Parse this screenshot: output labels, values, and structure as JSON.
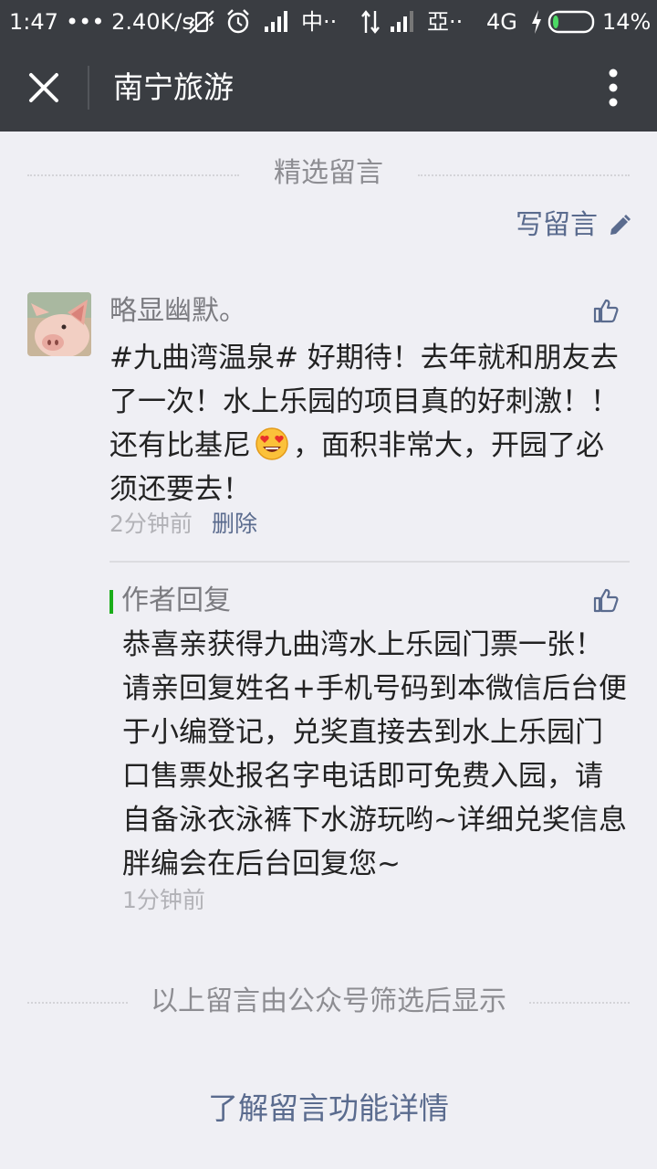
{
  "status_bar": {
    "time": "1:47",
    "speed": "••• 2.40K/s",
    "carrier1": "中··",
    "carrier2": "亞··",
    "network": "4G",
    "battery": "14%",
    "battery_level": 0.14
  },
  "header": {
    "title": "南宁旅游"
  },
  "section": {
    "title": "精选留言",
    "write_label": "写留言"
  },
  "comment": {
    "nickname": "略显幽默。",
    "text_before": "#九曲湾温泉# 好期待！去年就和朋友去了一次！水上乐园的项目真的好刺激！！还有比基尼",
    "text_after": "，面积非常大，开园了必须还要去！",
    "time": "2分钟前",
    "delete_label": "删除"
  },
  "reply": {
    "label": "作者回复",
    "text": "恭喜亲获得九曲湾水上乐园门票一张！请亲回复姓名+手机号码到本微信后台便于小编登记，兑奖直接去到水上乐园门口售票处报名字电话即可免费入园，请自备泳衣泳裤下水游玩哟~详细兑奖信息胖编会在后台回复您~",
    "time": "1分钟前"
  },
  "footer": {
    "note": "以上留言由公众号筛选后显示",
    "learn_more": "了解留言功能详情"
  },
  "colors": {
    "bar_bg": "#3a3d42",
    "page_bg": "#efeff4",
    "link": "#5a6b8e",
    "reply_accent": "#1aad19"
  }
}
